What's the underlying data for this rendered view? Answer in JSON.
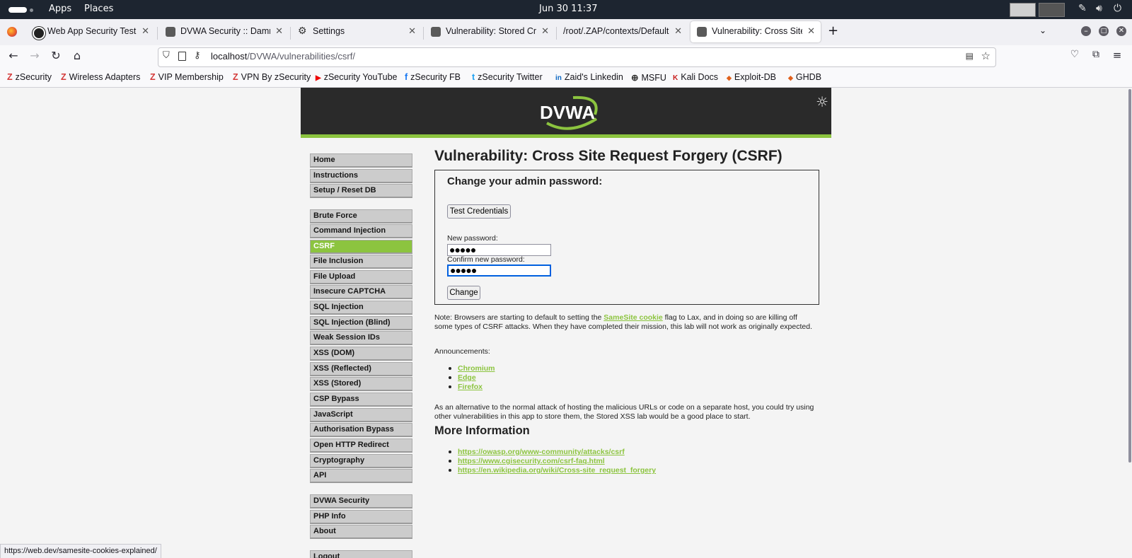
{
  "gnome_bar": {
    "apps": "Apps",
    "places": "Places",
    "clock": "Jun 30  11:37"
  },
  "tabs": [
    {
      "title": "Web App Security Testing"
    },
    {
      "title": "DVWA Security :: Damn Vulnerable"
    },
    {
      "title": "Settings"
    },
    {
      "title": "Vulnerability: Stored Cross"
    },
    {
      "title": "/root/.ZAP/contexts/Default"
    },
    {
      "title": "Vulnerability: Cross Site R"
    }
  ],
  "url": {
    "host": "localhost",
    "path": "/DVWA/vulnerabilities/csrf/"
  },
  "bookmarks": [
    {
      "icon": "Z",
      "label": "zSecurity"
    },
    {
      "icon": "Z",
      "label": "Wireless Adapters"
    },
    {
      "icon": "Z",
      "label": "VIP Membership"
    },
    {
      "icon": "Z",
      "label": "VPN By zSecurity"
    },
    {
      "icon": "▶",
      "label": "zSecurity YouTube"
    },
    {
      "icon": "f",
      "label": "zSecurity FB"
    },
    {
      "icon": "t",
      "label": "zSecurity Twitter"
    },
    {
      "icon": "in",
      "label": "Zaid's Linkedin"
    },
    {
      "icon": "⊕",
      "label": "MSFU"
    },
    {
      "icon": "K",
      "label": "Kali Docs"
    },
    {
      "icon": "◆",
      "label": "Exploit-DB"
    },
    {
      "icon": "◆",
      "label": "GHDB"
    }
  ],
  "logo_text": "DVWA",
  "menu": [
    {
      "label": "Home"
    },
    {
      "label": "Instructions"
    },
    {
      "label": "Setup / Reset DB"
    },
    {
      "label": "Brute Force"
    },
    {
      "label": "Command Injection"
    },
    {
      "label": "CSRF",
      "selected": true
    },
    {
      "label": "File Inclusion"
    },
    {
      "label": "File Upload"
    },
    {
      "label": "Insecure CAPTCHA"
    },
    {
      "label": "SQL Injection"
    },
    {
      "label": "SQL Injection (Blind)"
    },
    {
      "label": "Weak Session IDs"
    },
    {
      "label": "XSS (DOM)"
    },
    {
      "label": "XSS (Reflected)"
    },
    {
      "label": "XSS (Stored)"
    },
    {
      "label": "CSP Bypass"
    },
    {
      "label": "JavaScript"
    },
    {
      "label": "Authorisation Bypass"
    },
    {
      "label": "Open HTTP Redirect"
    },
    {
      "label": "Cryptography"
    },
    {
      "label": "API"
    },
    {
      "label": "DVWA Security"
    },
    {
      "label": "PHP Info"
    },
    {
      "label": "About"
    },
    {
      "label": "Logout"
    }
  ],
  "main": {
    "title": "Vulnerability: Cross Site Request Forgery (CSRF)",
    "form_heading": "Change your admin password:",
    "test_button": "Test Credentials",
    "new_password_label": "New password:",
    "new_password_value": "●●●●●",
    "confirm_password_label": "Confirm new password:",
    "confirm_password_value": "●●●●●",
    "change_button": "Change",
    "note_before": "Note: Browsers are starting to default to setting the ",
    "note_link": "SameSite cookie",
    "note_after": " flag to Lax, and in doing so are killing off some types of CSRF attacks. When they have completed their mission, this lab will not work as originally expected.",
    "announcements_label": "Announcements:",
    "announcements": [
      "Chromium",
      "Edge",
      "Firefox"
    ],
    "alternative_text": "As an alternative to the normal attack of hosting the malicious URLs or code on a separate host, you could try using other vulnerabilities in this app to store them, the Stored XSS lab would be a good place to start.",
    "more_info_heading": "More Information",
    "more_info_links": [
      "https://owasp.org/www-community/attacks/csrf",
      "https://www.cgisecurity.com/csrf-faq.html",
      "https://en.wikipedia.org/wiki/Cross-site_request_forgery"
    ]
  },
  "status_url": "https://web.dev/samesite-cookies-explained/",
  "colors": {
    "accent": "#8cc43f",
    "header_bg": "#2a2a2a",
    "tab_bar": "#f0f0f4",
    "topbar": "#1d2530"
  }
}
